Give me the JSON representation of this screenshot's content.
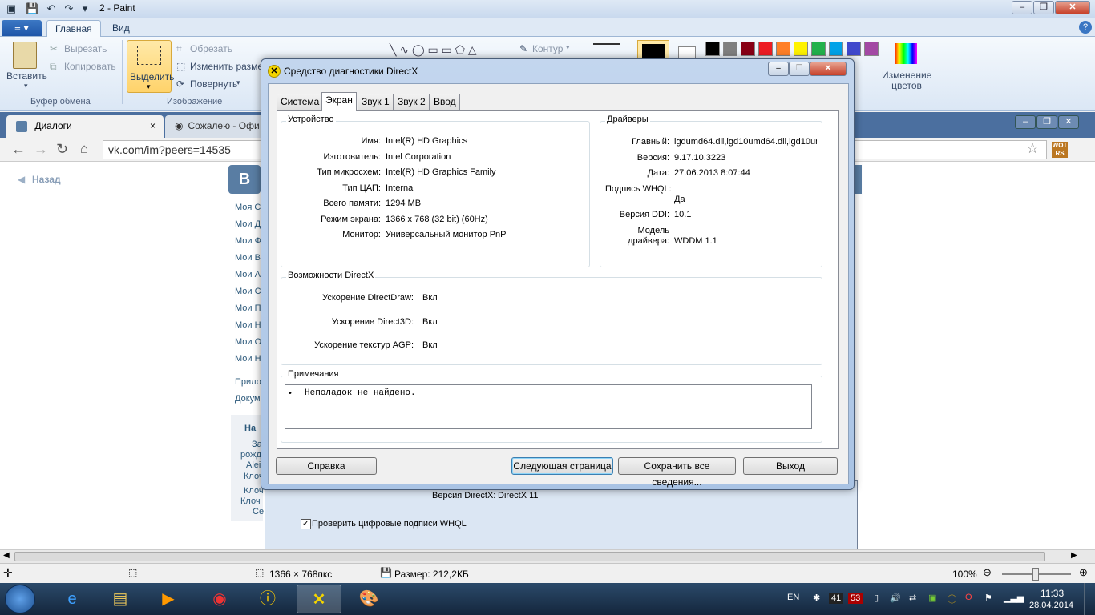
{
  "paint": {
    "title": "2 - Paint",
    "tabs": [
      {
        "label": "Главная"
      },
      {
        "label": "Вид"
      }
    ],
    "file_menu_icon": "menu-icon",
    "clipboard": {
      "paste": "Вставить",
      "cut": "Вырезать",
      "copy": "Копировать",
      "caption": "Буфер обмена"
    },
    "image": {
      "select": "Выделить",
      "crop": "Обрезать",
      "resize": "Изменить разме",
      "rotate": "Повернуть",
      "caption": "Изображение"
    },
    "shapes": {
      "outline": "Контур"
    },
    "edit_colors": "Изменение цветов",
    "palette": [
      "#000000",
      "#7f7f7f",
      "#880015",
      "#ed1c24",
      "#ff7f27",
      "#fff200",
      "#22b14c",
      "#00a2e8",
      "#3f48cc",
      "#a349a4"
    ],
    "status": {
      "size": "1366 × 768пкс",
      "filesize": "Размер: 212,2КБ",
      "zoom": "100%"
    }
  },
  "browser": {
    "tab1": "Диалоги",
    "tab2": "Сожалею - Офи",
    "url": "vk.com/im?peers=14535",
    "back_link": "Назад",
    "vk_logo": "B",
    "left_menu": [
      "Моя С",
      "Мои Д",
      "Мои Ф",
      "Мои В",
      "Мои А",
      "Мои С",
      "Мои П",
      "Мои Н",
      "Мои О",
      "Мои Н"
    ],
    "left_extra": [
      "Прило",
      "Докум"
    ],
    "friends_block": [
      "На",
      "За",
      "рожд",
      "Alei",
      "Клоч",
      "Клоч",
      "Клоч",
      "Се"
    ]
  },
  "dxdiag": {
    "title": "Средство диагностики DirectX",
    "tabs": [
      "Система",
      "Экран",
      "Звук 1",
      "Звук 2",
      "Ввод"
    ],
    "active_tab": "Экран",
    "device": {
      "caption": "Устройство",
      "rows": [
        {
          "label": "Имя:",
          "value": "Intel(R) HD Graphics"
        },
        {
          "label": "Изготовитель:",
          "value": "Intel Corporation"
        },
        {
          "label": "Тип микросхем:",
          "value": "Intel(R) HD Graphics Family"
        },
        {
          "label": "Тип ЦАП:",
          "value": "Internal"
        },
        {
          "label": "Всего памяти:",
          "value": "1294 MB"
        },
        {
          "label": "Режим экрана:",
          "value": "1366 x 768 (32 bit) (60Hz)"
        },
        {
          "label": "Монитор:",
          "value": "Универсальный монитор PnP"
        }
      ]
    },
    "drivers": {
      "caption": "Драйверы",
      "main_label": "Главный:",
      "main_value": "igdumd64.dll,igd10umd64.dll,igd10um",
      "version_label": "Версия:",
      "version_value": "9.17.10.3223",
      "date_label": "Дата:",
      "date_value": "27.06.2013 8:07:44",
      "whql_label": "Подпись WHQL:",
      "whql_value": "Да",
      "ddi_label": "Версия DDI:",
      "ddi_value": "10.1",
      "model_label1": "Модель",
      "model_label2": "драйвера:",
      "model_value": "WDDM 1.1"
    },
    "features": {
      "caption": "Возможности DirectX",
      "rows": [
        {
          "label": "Ускорение DirectDraw:",
          "value": "Вкл"
        },
        {
          "label": "Ускорение Direct3D:",
          "value": "Вкл"
        },
        {
          "label": "Ускорение текстур AGP:",
          "value": "Вкл"
        }
      ]
    },
    "notes": {
      "caption": "Примечания",
      "items": [
        "Неполадок не найдено."
      ]
    },
    "buttons": {
      "help": "Справка",
      "next": "Следующая страница",
      "save": "Сохранить все сведения...",
      "exit": "Выход"
    },
    "back": {
      "version_label": "Версия DirectX:",
      "version_value": "DirectX 11",
      "whql_check": "Проверить цифровые подписи WHQL"
    }
  },
  "taskbar": {
    "lang": "EN",
    "time": "11:33",
    "date": "28.04.2014",
    "badge1": "41",
    "badge2": "53"
  }
}
